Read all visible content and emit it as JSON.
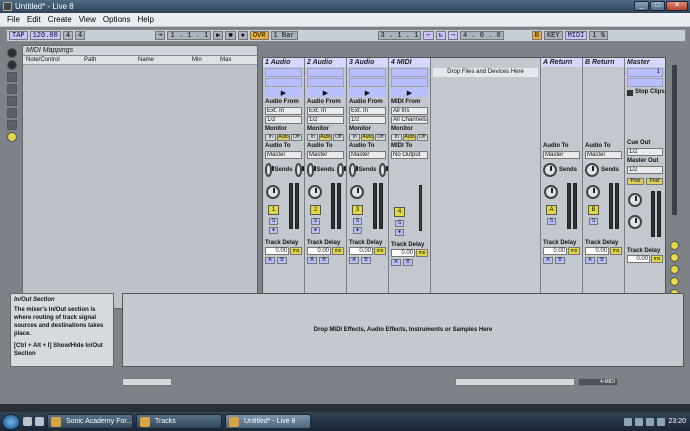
{
  "window": {
    "title": "Untitled* - Live 8",
    "min": "_",
    "max": "□",
    "close": "✕"
  },
  "menu": [
    "File",
    "Edit",
    "Create",
    "View",
    "Options",
    "Help"
  ],
  "transport": {
    "tap": "TAP",
    "tempo": "120.00",
    "time_sig_num": "4",
    "time_sig_den": "4",
    "position": "1 . 1 . 1",
    "ovr": "OVR",
    "quantize": "1 Bar",
    "loop_start": "3 . 1 . 1",
    "loop_len": "4 . 0 . 0",
    "key": "KEY",
    "midi": "MIDI",
    "b": "B",
    "cpu": "1 %"
  },
  "midi_panel": {
    "title": "MIDI Mappings",
    "columns": [
      "Note/Control",
      "Path",
      "Name",
      "Min",
      "Max"
    ]
  },
  "drop_text": "Drop Files and Devices Here",
  "tracks": [
    {
      "name": "1 Audio",
      "from_label": "Audio From",
      "from": "Ext. In",
      "channel": "1/2",
      "monitor_label": "Monitor",
      "to_label": "Audio To",
      "to": "Master",
      "num": "1",
      "delay_label": "Track Delay",
      "delay": "0.00",
      "unit": "ms"
    },
    {
      "name": "2 Audio",
      "from_label": "Audio From",
      "from": "Ext. In",
      "channel": "1/2",
      "monitor_label": "Monitor",
      "to_label": "Audio To",
      "to": "Master",
      "num": "2",
      "delay_label": "Track Delay",
      "delay": "0.00",
      "unit": "ms"
    },
    {
      "name": "3 Audio",
      "from_label": "Audio From",
      "from": "Ext. In",
      "channel": "1/2",
      "monitor_label": "Monitor",
      "to_label": "Audio To",
      "to": "Master",
      "num": "3",
      "delay_label": "Track Delay",
      "delay": "0.00",
      "unit": "ms"
    },
    {
      "name": "4 MIDI",
      "from_label": "MIDI From",
      "from": "All Ins",
      "channel": "All Channels",
      "monitor_label": "Monitor",
      "to_label": "MIDI To",
      "to": "No Output",
      "num": "4",
      "delay_label": "Track Delay",
      "delay": "0.00",
      "unit": "ms"
    }
  ],
  "monitor_opts": [
    "In",
    "Auto",
    "Off"
  ],
  "sends_label": "Sends",
  "returns": [
    {
      "name": "A Return",
      "to_label": "Audio To",
      "to": "Master",
      "letter": "A",
      "delay_label": "Track Delay",
      "delay": "0.00",
      "unit": "ms"
    },
    {
      "name": "B Return",
      "to_label": "Audio To",
      "to": "Master",
      "letter": "B",
      "delay_label": "Track Delay",
      "delay": "0.00",
      "unit": "ms"
    }
  ],
  "master": {
    "name": "Master",
    "slot": "1",
    "stop": "Stop Clips",
    "cue_label": "Cue Out",
    "cue": "1/2",
    "out_label": "Master Out",
    "out": "1/2",
    "post1": "Post",
    "post2": "Post",
    "delay_label": "Track Delay",
    "delay": "0.00",
    "unit": "ms"
  },
  "info": {
    "title": "In/Out Section",
    "p1": "The mixer's In/Out section is where routing of track signal sources and destinations takes place.",
    "p2": "[Ctrl + Alt + I] Show/Hide In/Out Section"
  },
  "device_drop": "Drop MIDI Effects, Audio Effects, Instruments or Samples Here",
  "status_right": "4-MIDI",
  "taskbar": {
    "tasks": [
      "Sonic Academy For...",
      "Tracks",
      "Untitled* - Live 8"
    ],
    "clock": "23:20"
  }
}
